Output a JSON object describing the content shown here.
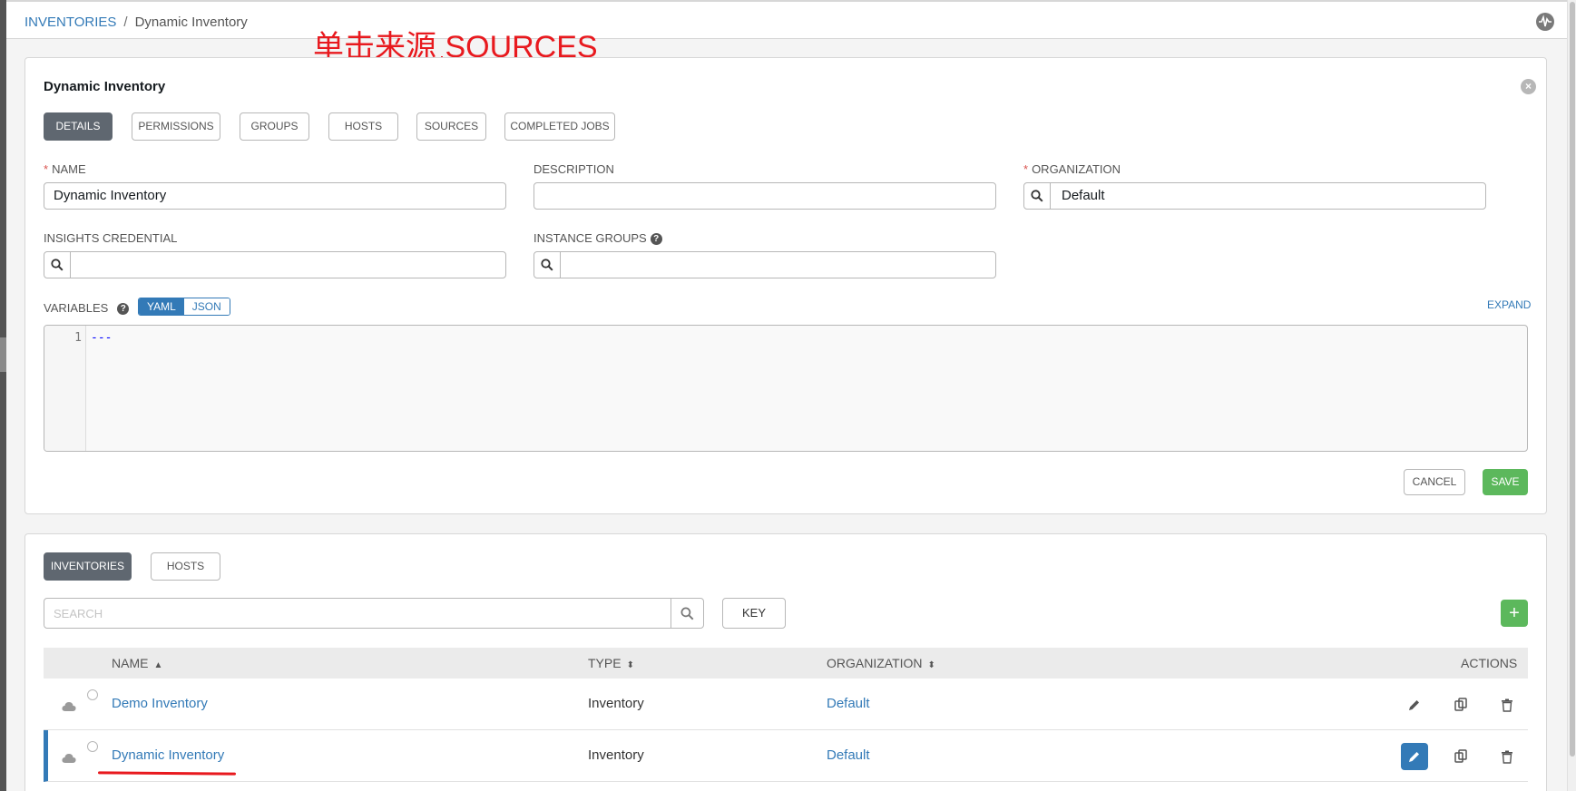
{
  "breadcrumb": {
    "parent": "INVENTORIES",
    "separator": "/",
    "current": "Dynamic Inventory"
  },
  "annotation": {
    "text": "单击来源 SOURCES"
  },
  "form": {
    "title": "Dynamic Inventory",
    "close_icon": "times-circle-icon",
    "tabs": [
      "DETAILS",
      "PERMISSIONS",
      "GROUPS",
      "HOSTS",
      "SOURCES",
      "COMPLETED JOBS"
    ],
    "active_tab": "DETAILS",
    "fields": {
      "name": {
        "label": "NAME",
        "required": "*",
        "value": "Dynamic Inventory"
      },
      "description": {
        "label": "DESCRIPTION",
        "value": ""
      },
      "organization": {
        "label": "ORGANIZATION",
        "required": "*",
        "value": "Default"
      },
      "insights_credential": {
        "label": "INSIGHTS CREDENTIAL",
        "value": ""
      },
      "instance_groups": {
        "label": "INSTANCE GROUPS",
        "value": "",
        "help": "?"
      }
    },
    "variables": {
      "label": "VARIABLES",
      "help": "?",
      "format_options": [
        "YAML",
        "JSON"
      ],
      "selected_format": "YAML",
      "expand_label": "EXPAND",
      "line_numbers": [
        "1"
      ],
      "content": "---"
    },
    "cancel_label": "CANCEL",
    "save_label": "SAVE"
  },
  "list": {
    "tabs": [
      "INVENTORIES",
      "HOSTS"
    ],
    "active_tab": "INVENTORIES",
    "search_placeholder": "SEARCH",
    "key_label": "KEY",
    "add_label": "+",
    "columns": {
      "name": "NAME",
      "type": "TYPE",
      "organization": "ORGANIZATION",
      "actions": "ACTIONS"
    },
    "rows": [
      {
        "name": "Demo Inventory",
        "type": "Inventory",
        "organization": "Default",
        "selected": false
      },
      {
        "name": "Dynamic Inventory",
        "type": "Inventory",
        "organization": "Default",
        "selected": true
      }
    ]
  },
  "colors": {
    "accent": "#337ab7",
    "save": "#5cb85c",
    "annotation": "#e8191e",
    "active_tab": "#5f6770"
  }
}
